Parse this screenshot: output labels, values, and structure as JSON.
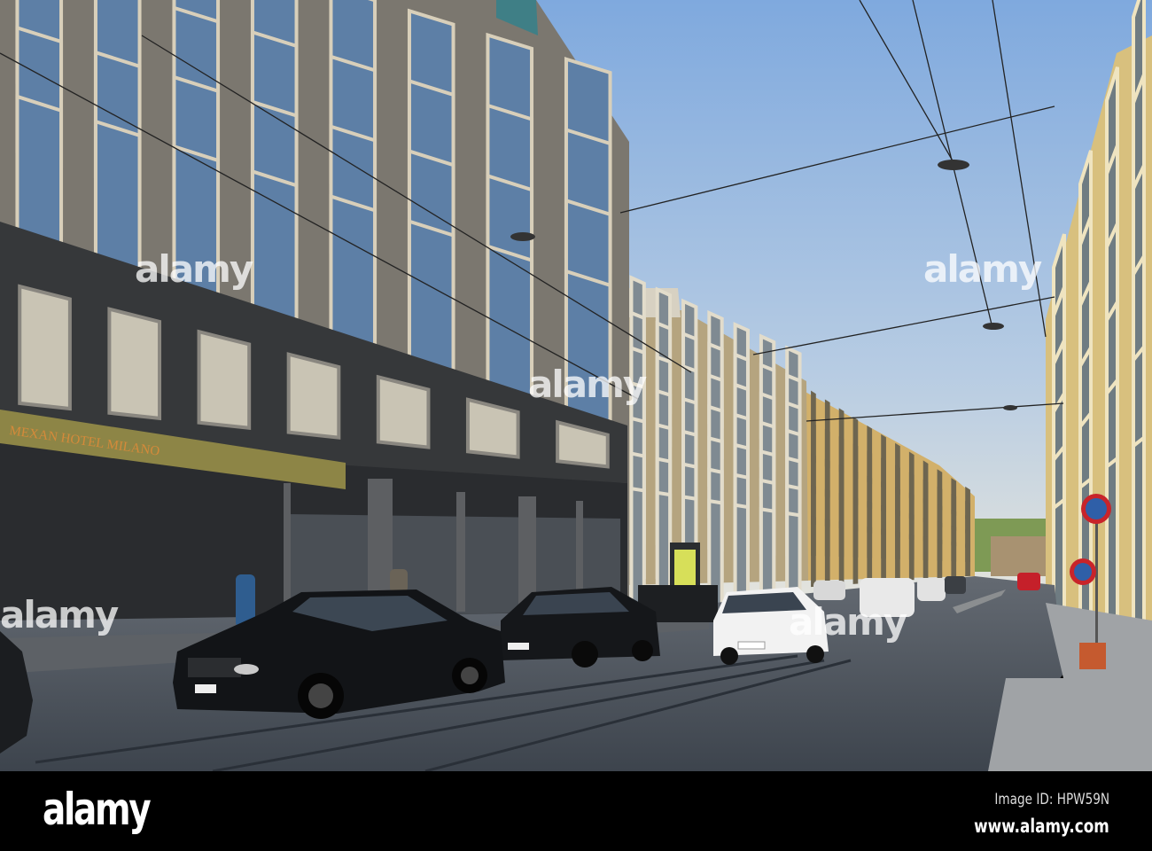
{
  "photo": {
    "hotel_sign": "MEXAN HOTEL MILANO",
    "watermarks": [
      "alamy",
      "alamy",
      "alamy",
      "alamy",
      "alamy"
    ]
  },
  "footer": {
    "logo": "alamy",
    "image_id": "Image ID: HPW59N",
    "url": "www.alamy.com"
  },
  "colors": {
    "sky_top": "#7fa9de",
    "sky_bottom": "#e6e8e6",
    "granite": "#7b776f",
    "dark_band": "#36383a",
    "street": "#4b535c",
    "bar": "#000000"
  }
}
